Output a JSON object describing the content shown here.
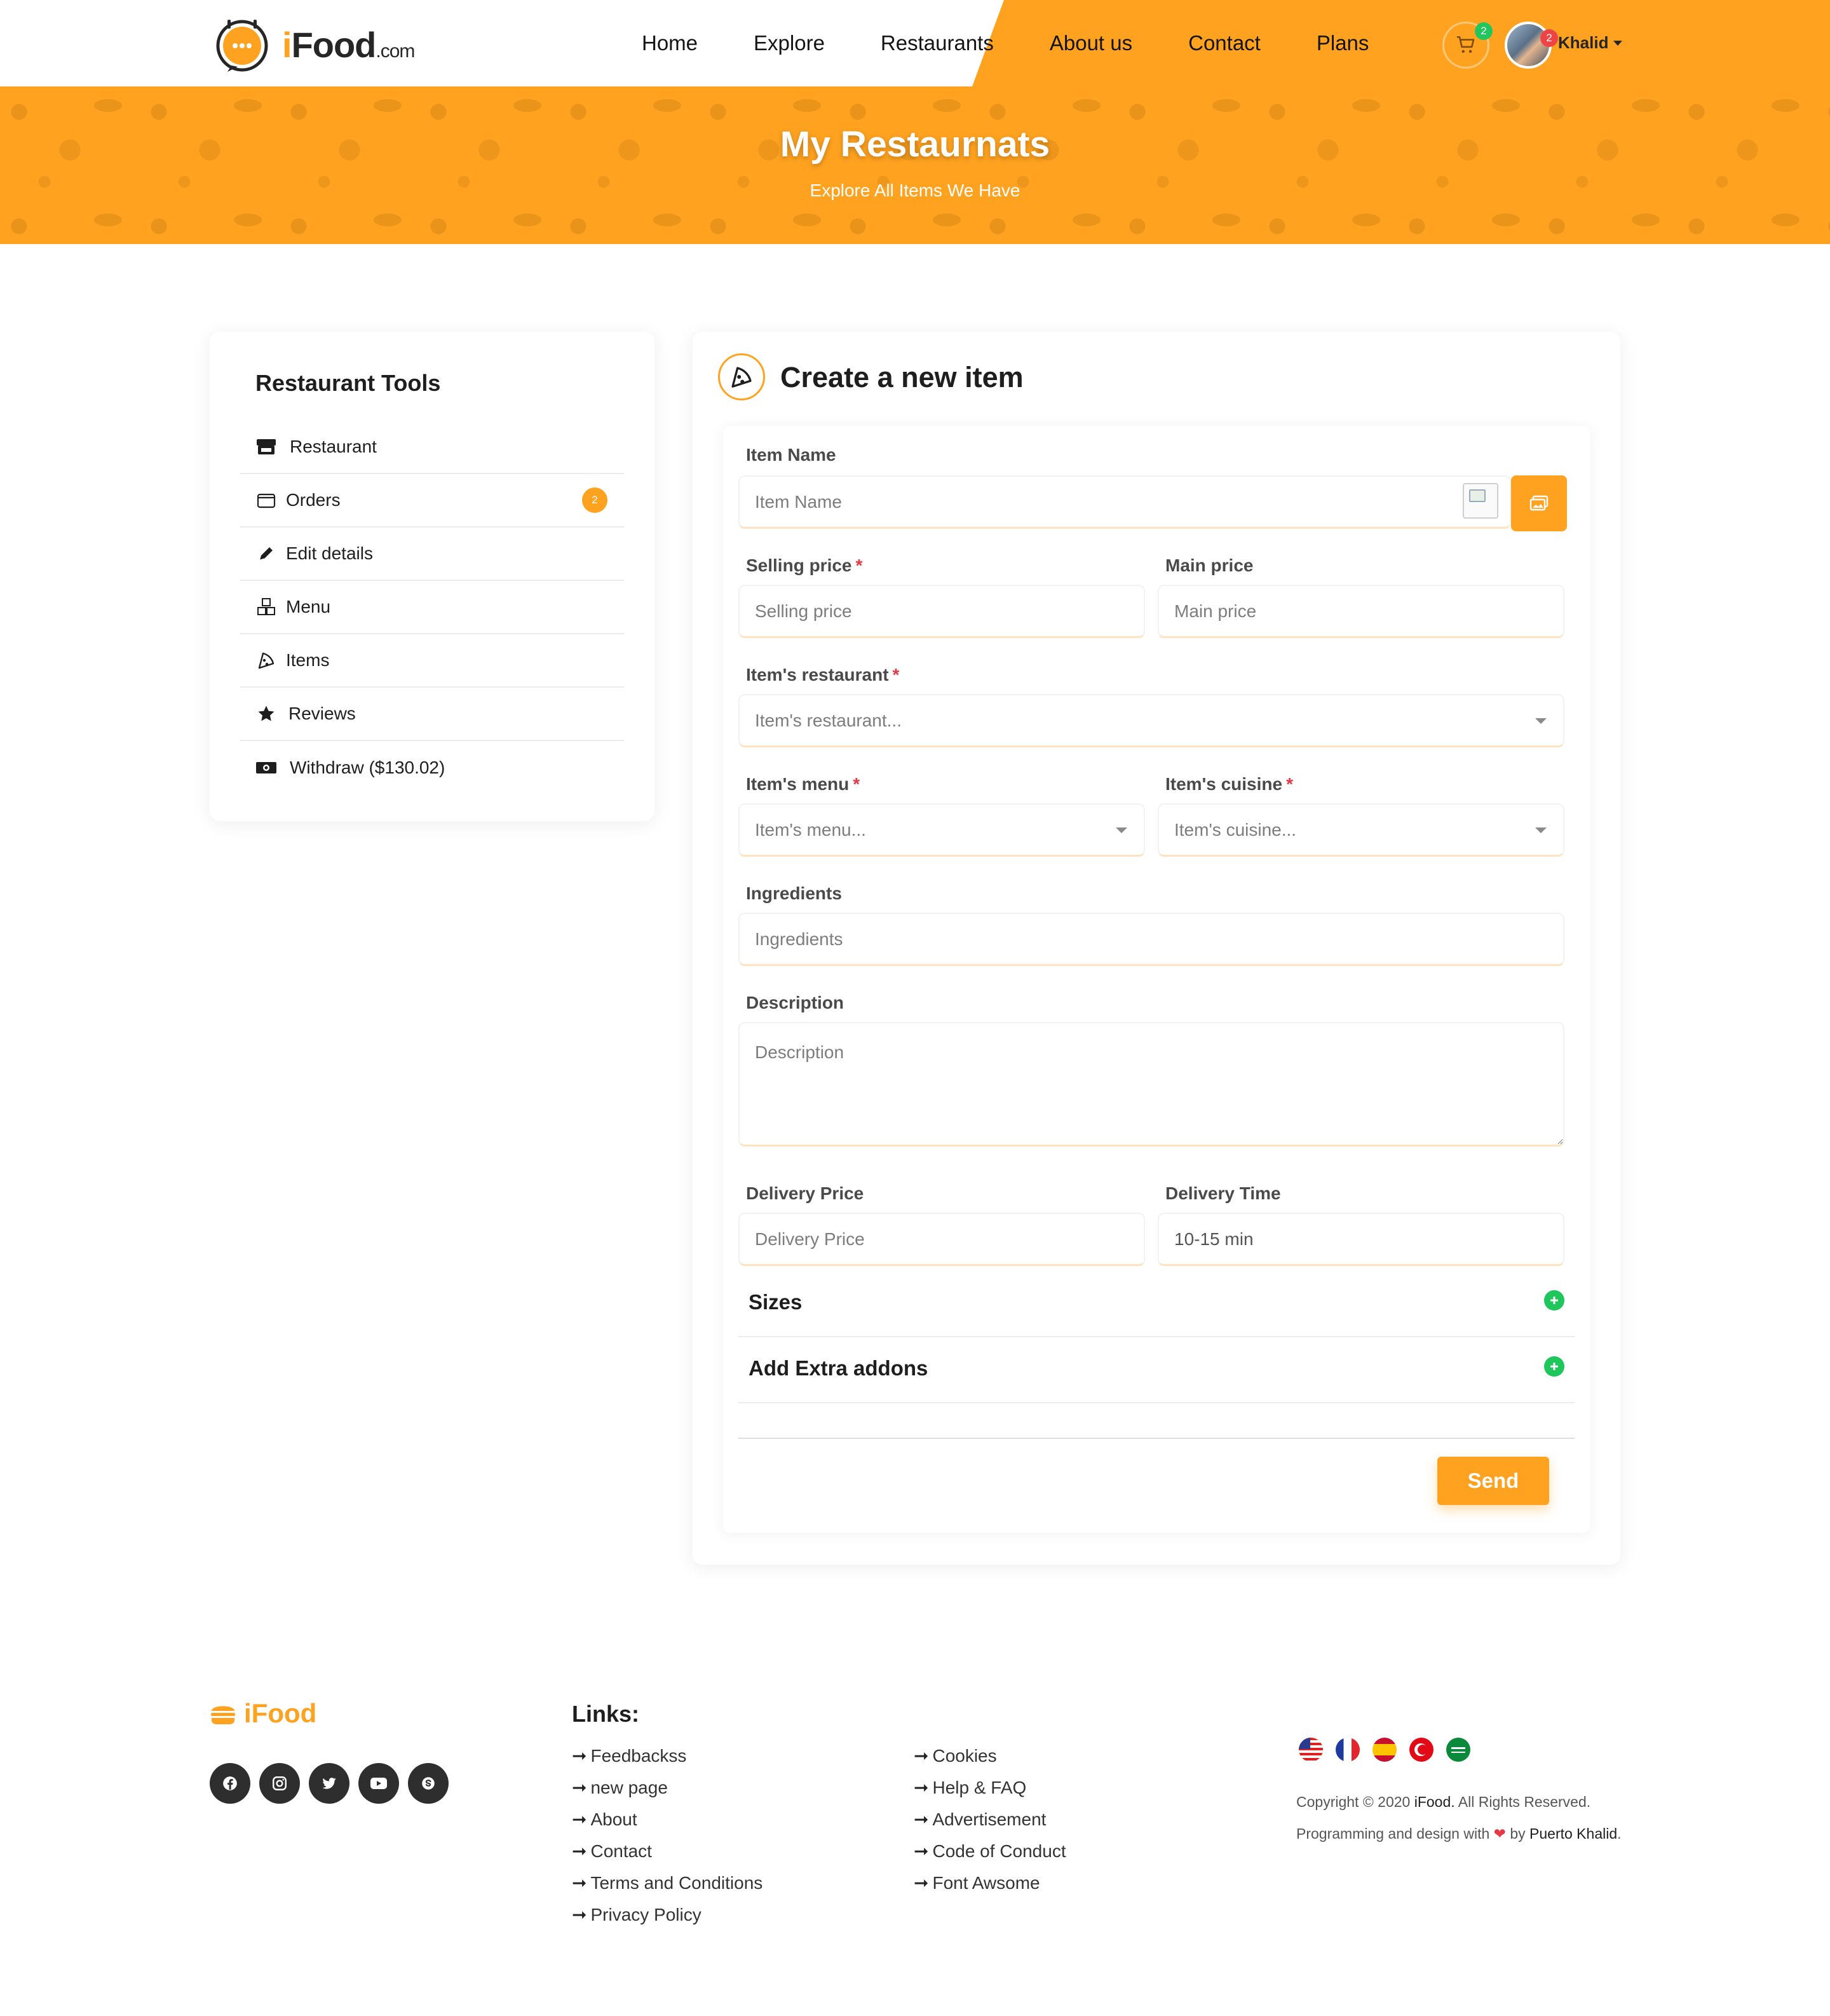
{
  "brand": {
    "logo_i": "i",
    "logo_food": "Food",
    "logo_com": ".com",
    "footer_logo": "iFood",
    "accent_color": "#ffa21f"
  },
  "nav": {
    "links": [
      "Home",
      "Explore",
      "Restaurants",
      "About us",
      "Contact",
      "Plans"
    ],
    "cart_count": "2",
    "notification_count": "2",
    "user_name": "Khalid"
  },
  "hero": {
    "title": "My Restaurnats",
    "subtitle": "Explore All Items We Have"
  },
  "tools": {
    "title": "Restaurant Tools",
    "items": [
      {
        "label": "Restaurant",
        "icon": "store-icon"
      },
      {
        "label": "Orders",
        "icon": "wallet-icon",
        "badge": "2"
      },
      {
        "label": "Edit details",
        "icon": "pencil-icon"
      },
      {
        "label": "Menu",
        "icon": "cubes-icon"
      },
      {
        "label": "Items",
        "icon": "pizza-slice-icon"
      },
      {
        "label": "Reviews",
        "icon": "star-icon"
      },
      {
        "label": "Withdraw ($130.02)",
        "icon": "money-bill-icon"
      }
    ]
  },
  "form": {
    "title": "Create a new item",
    "item_name": {
      "label": "Item Name",
      "placeholder": "Item Name"
    },
    "selling_price": {
      "label": "Selling price",
      "placeholder": "Selling price",
      "required": "*"
    },
    "main_price": {
      "label": "Main price",
      "placeholder": "Main price"
    },
    "restaurant": {
      "label": "Item's restaurant",
      "placeholder": "Item's restaurant...",
      "required": "*"
    },
    "menu": {
      "label": "Item's menu",
      "placeholder": "Item's menu...",
      "required": "*"
    },
    "cuisine": {
      "label": "Item's cuisine",
      "placeholder": "Item's cuisine...",
      "required": "*"
    },
    "ingredients": {
      "label": "Ingredients",
      "placeholder": "Ingredients"
    },
    "description": {
      "label": "Description",
      "placeholder": "Description"
    },
    "delivery_price": {
      "label": "Delivery Price",
      "placeholder": "Delivery Price"
    },
    "delivery_time": {
      "label": "Delivery Time",
      "value": "10-15 min"
    },
    "sizes_title": "Sizes",
    "addons_title": "Add Extra addons",
    "send_label": "Send"
  },
  "footer": {
    "links_title": "Links:",
    "arrow": "➞",
    "col1": [
      "Feedbackss",
      "new page",
      "About",
      "Contact",
      "Terms and Conditions",
      "Privacy Policy"
    ],
    "col2": [
      "Cookies",
      "Help & FAQ",
      "Advertisement",
      "Code of Conduct",
      "Font Awsome"
    ],
    "socials": [
      "facebook-icon",
      "instagram-icon",
      "twitter-icon",
      "youtube-icon",
      "skype-icon"
    ],
    "flags": [
      "us-flag",
      "france-flag",
      "spain-flag",
      "turkey-flag",
      "saudi-flag"
    ],
    "copyright_prefix": "Copyright © 2020",
    "copyright_brand": "iFood.",
    "copyright_suffix": "All Rights Reserved.",
    "credit_prefix": "Programming and design with",
    "credit_by": "by",
    "credit_name": "Puerto Khalid",
    "credit_end": "."
  }
}
